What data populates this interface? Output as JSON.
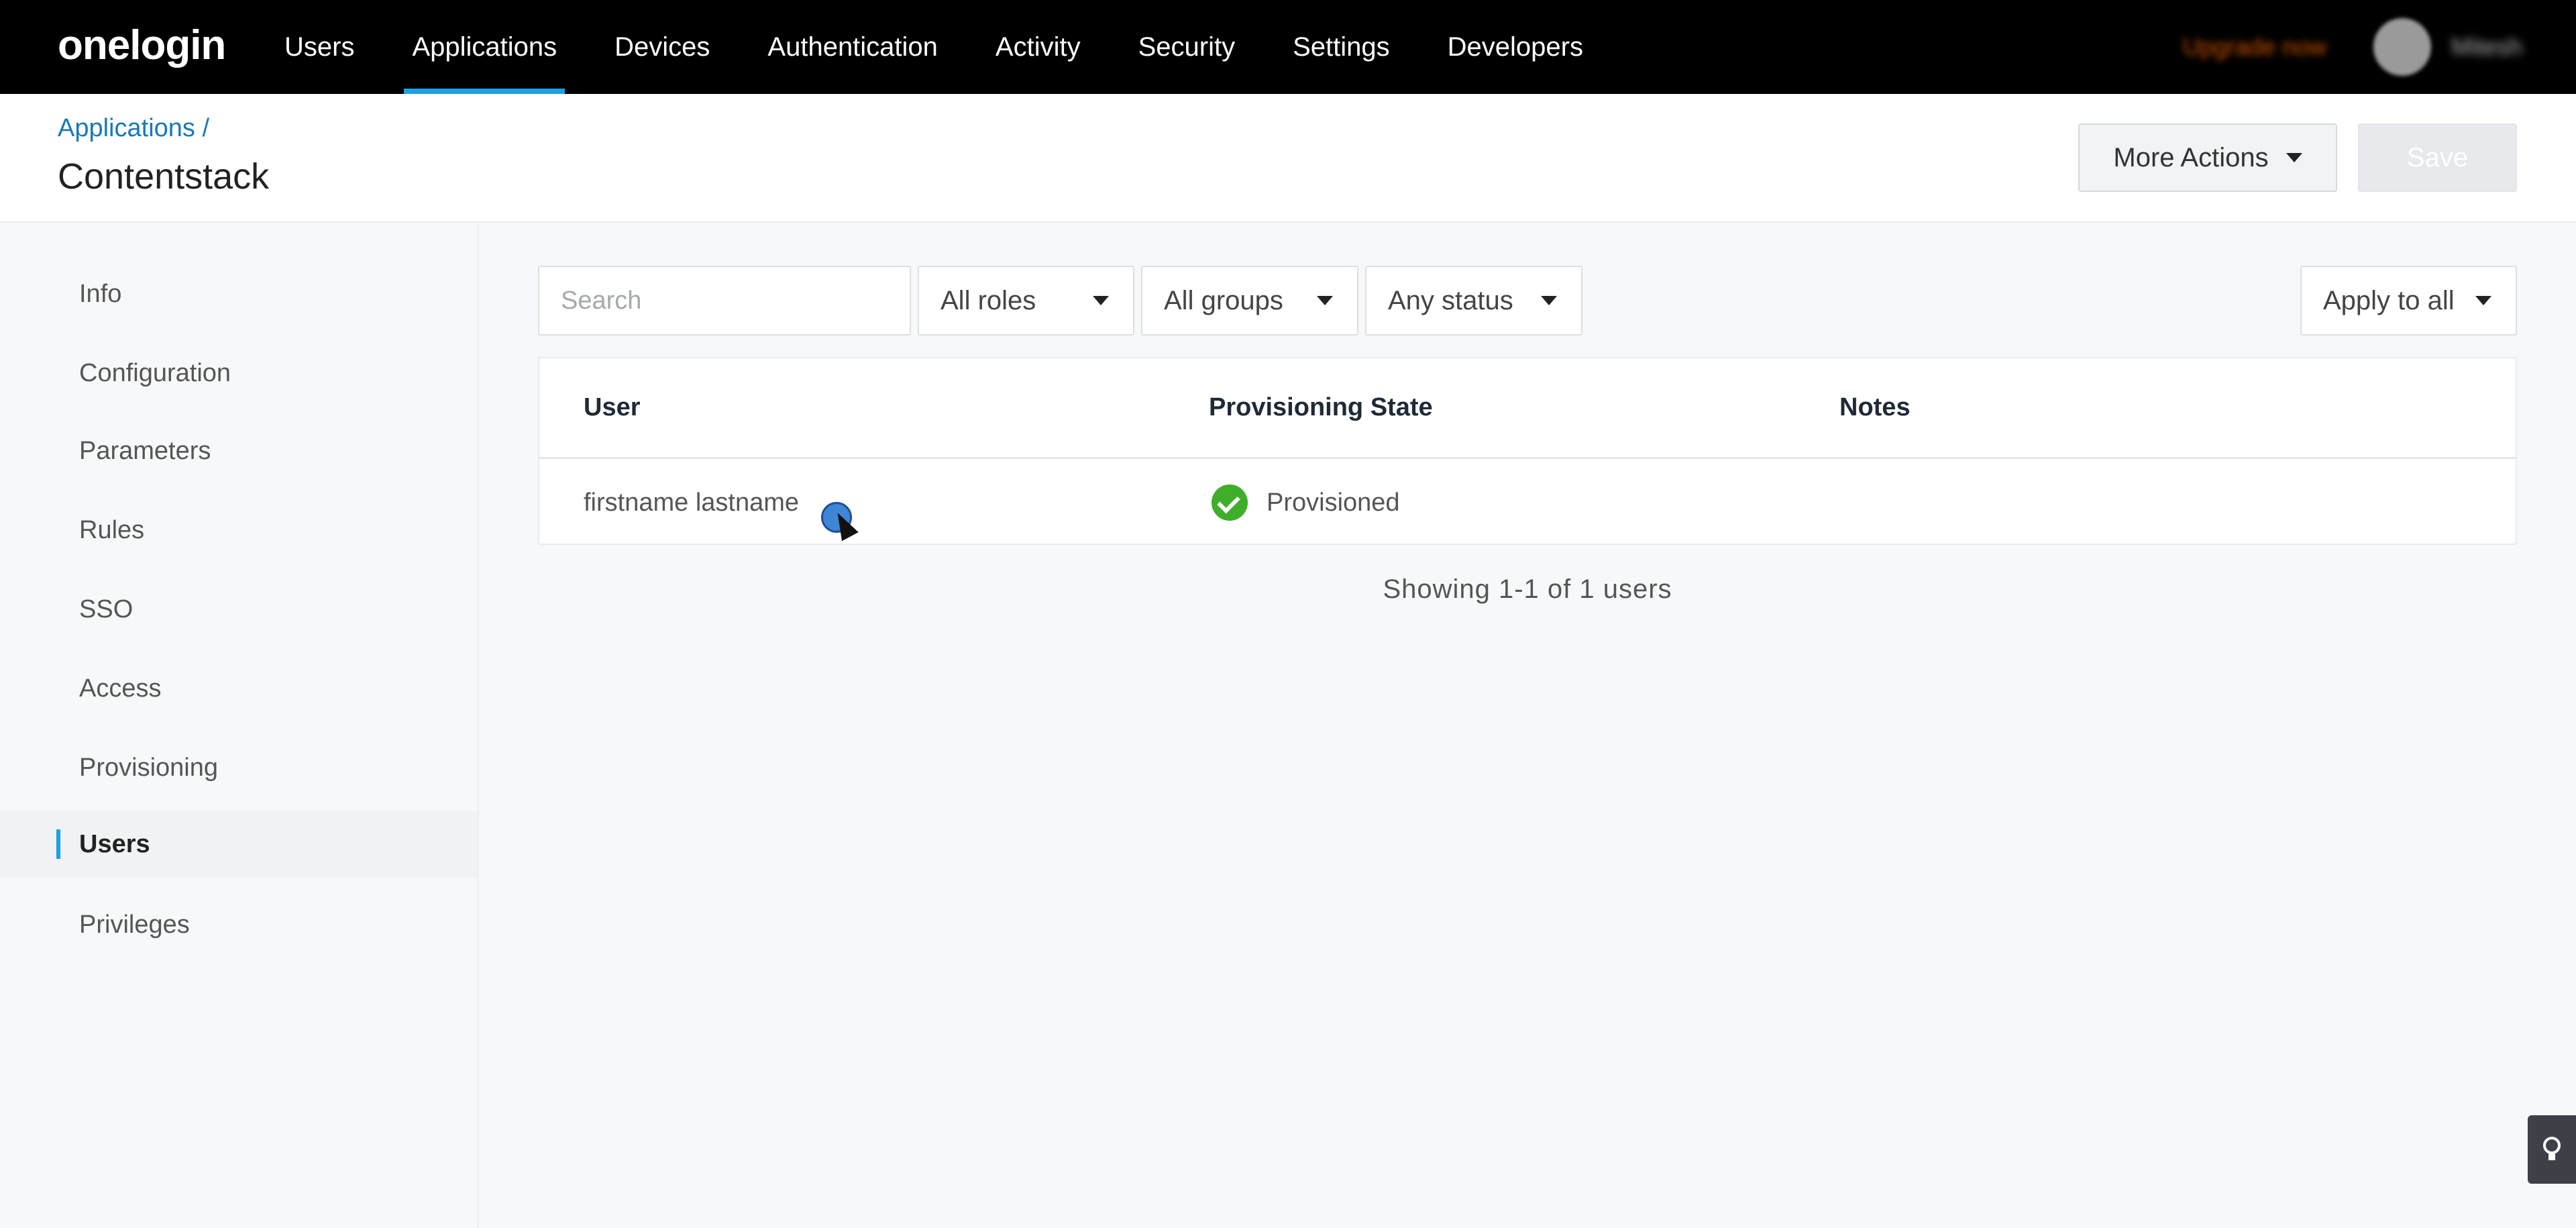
{
  "brand": {
    "logo": "onelogin"
  },
  "topnav": {
    "items": [
      {
        "label": "Users"
      },
      {
        "label": "Applications"
      },
      {
        "label": "Devices"
      },
      {
        "label": "Authentication"
      },
      {
        "label": "Activity"
      },
      {
        "label": "Security"
      },
      {
        "label": "Settings"
      },
      {
        "label": "Developers"
      }
    ],
    "active_index": 1,
    "upgrade_label": "Upgrade now",
    "user_name": "Mitesh"
  },
  "header": {
    "breadcrumb": "Applications /",
    "title": "Contentstack",
    "more_actions_label": "More Actions",
    "save_label": "Save"
  },
  "sidebar": {
    "items": [
      {
        "label": "Info"
      },
      {
        "label": "Configuration"
      },
      {
        "label": "Parameters"
      },
      {
        "label": "Rules"
      },
      {
        "label": "SSO"
      },
      {
        "label": "Access"
      },
      {
        "label": "Provisioning"
      },
      {
        "label": "Users"
      },
      {
        "label": "Privileges"
      }
    ],
    "active_index": 7
  },
  "filters": {
    "search_placeholder": "Search",
    "roles": "All roles",
    "groups": "All groups",
    "status": "Any status",
    "apply_all": "Apply to all"
  },
  "table": {
    "columns": [
      "User",
      "Provisioning State",
      "Notes"
    ],
    "rows": [
      {
        "user": "firstname lastname",
        "state": "Provisioned",
        "notes": ""
      }
    ]
  },
  "summary": "Showing 1-1 of 1 users",
  "colors": {
    "accent": "#1da1e6",
    "link": "#1a78b9",
    "success": "#3fae2a"
  },
  "icons": [
    "caret-down-icon",
    "check-circle-icon",
    "lightbulb-icon"
  ]
}
